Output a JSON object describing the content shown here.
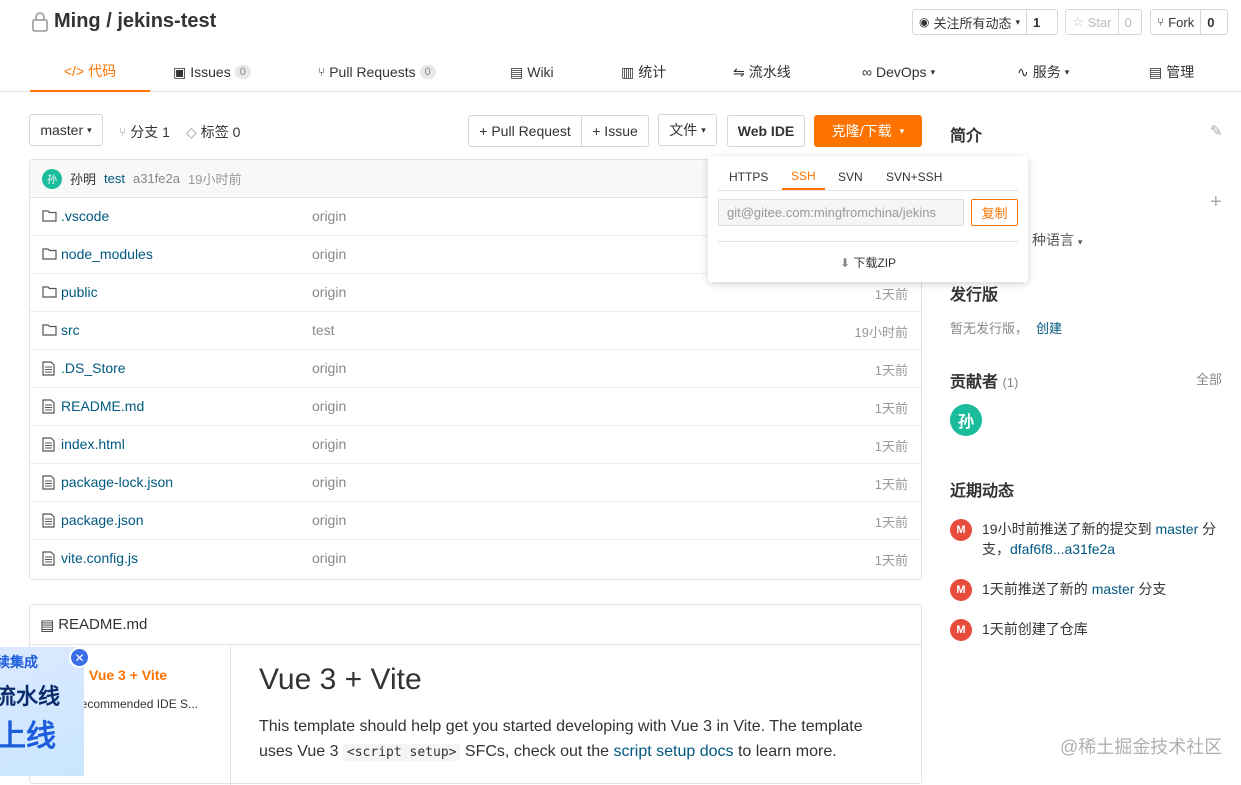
{
  "repo": {
    "owner": "Ming",
    "sep": " / ",
    "name": "jekins-test"
  },
  "header_buttons": {
    "watch": {
      "label": "关注所有动态",
      "count": "1"
    },
    "star": {
      "label": "Star",
      "count": "0"
    },
    "fork": {
      "label": "Fork",
      "count": "0"
    }
  },
  "tabs": [
    {
      "label": "代码"
    },
    {
      "label": "Issues",
      "badge": "0"
    },
    {
      "label": "Pull Requests",
      "badge": "0"
    },
    {
      "label": "Wiki"
    },
    {
      "label": "统计"
    },
    {
      "label": "流水线"
    },
    {
      "label": "DevOps"
    },
    {
      "label": "服务"
    },
    {
      "label": "管理"
    }
  ],
  "toolbar": {
    "branch": "master",
    "branches": "分支 1",
    "tags": "标签 0",
    "pull_request": "+ Pull Request",
    "issue": "+ Issue",
    "file": "文件",
    "web_ide": "Web IDE",
    "clone": "克隆/下载"
  },
  "commit": {
    "avatar": "孙",
    "author": "孙明",
    "message": "test",
    "hash": "a31fe2a",
    "time": "19小时前"
  },
  "files": [
    {
      "name": ".vscode",
      "type": "folder",
      "msg": "origin",
      "time": ""
    },
    {
      "name": "node_modules",
      "type": "folder",
      "msg": "origin",
      "time": ""
    },
    {
      "name": "public",
      "type": "folder",
      "msg": "origin",
      "time": "1天前"
    },
    {
      "name": "src",
      "type": "folder",
      "msg": "test",
      "time": "19小时前"
    },
    {
      "name": ".DS_Store",
      "type": "file",
      "msg": "origin",
      "time": "1天前"
    },
    {
      "name": "README.md",
      "type": "file",
      "msg": "origin",
      "time": "1天前"
    },
    {
      "name": "index.html",
      "type": "file",
      "msg": "origin",
      "time": "1天前"
    },
    {
      "name": "package-lock.json",
      "type": "file",
      "msg": "origin",
      "time": "1天前"
    },
    {
      "name": "package.json",
      "type": "file",
      "msg": "origin",
      "time": "1天前"
    },
    {
      "name": "vite.config.js",
      "type": "file",
      "msg": "origin",
      "time": "1天前"
    }
  ],
  "clone_dropdown": {
    "tabs": [
      "HTTPS",
      "SSH",
      "SVN",
      "SVN+SSH"
    ],
    "active": "SSH",
    "url": "git@gitee.com:mingfromchina/jekins",
    "copy": "复制",
    "download": "下载ZIP"
  },
  "readme": {
    "filename": "README.md",
    "toc_title": "Vue 3 + Vite",
    "toc_sub": "Recommended IDE S...",
    "heading": "Vue 3 + Vite",
    "para_1": "This template should help get you started developing with Vue 3 in Vite. The template",
    "para_2a": "uses Vue 3 ",
    "code": "<script setup>",
    "para_2b": " SFCs, check out the ",
    "link": "script setup docs",
    "para_2c": " to learn more."
  },
  "sidebar": {
    "intro": "简介",
    "lang_fragment": "种语言",
    "release": "发行版",
    "release_empty": "暂无发行版，",
    "release_create": "创建",
    "contributors": "贡献者",
    "contributors_count": "(1)",
    "contributors_all": "全部",
    "contributor_avatar": "孙",
    "recent": "近期动态",
    "activities": [
      {
        "avatar": "M",
        "text_a": "19小时前推送了新的提交到 ",
        "link_a": "master",
        "text_b": " 分支，",
        "link_b": "dfaf6f8...a31fe2a"
      },
      {
        "avatar": "M",
        "text_a": "1天前推送了新的 ",
        "link_a": "master",
        "text_b": " 分支"
      },
      {
        "avatar": "M",
        "text_a": "1天前创建了仓库"
      }
    ]
  },
  "promo": {
    "line1": "续集成",
    "line2": "流水线",
    "line3": "上线"
  },
  "watermark": "@稀土掘金技术社区",
  "colors": {
    "accent": "#fe7300",
    "link": "#005980",
    "avatar_green": "#1abc9c",
    "avatar_red": "#e74c3c"
  }
}
